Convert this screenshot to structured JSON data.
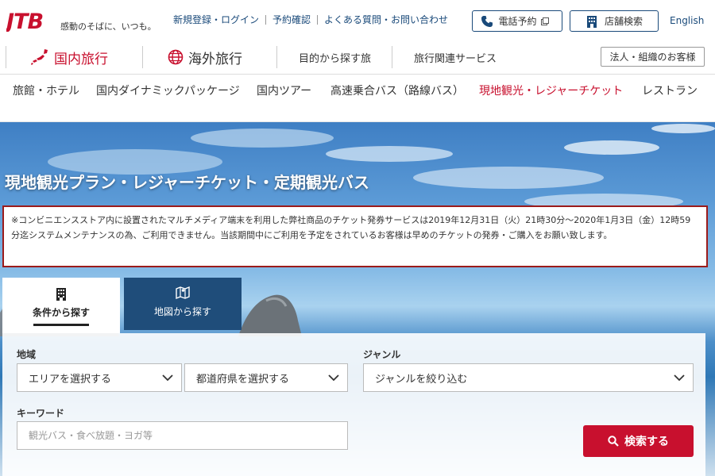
{
  "header": {
    "logo_text": "JTB",
    "tagline": "感動のそばに、いつも。",
    "links": [
      "新規登録・ログイン",
      "予約確認",
      "よくある質問・お問い合わせ"
    ],
    "phone_label": "電話予約",
    "store_label": "店舗検索",
    "english_label": "English"
  },
  "main_nav": {
    "domestic": "国内旅行",
    "overseas": "海外旅行",
    "purpose": "目的から探す旅",
    "related": "旅行関連サービス",
    "corporate": "法人・組織のお客様"
  },
  "sub_nav": [
    {
      "label": "旅館・ホテル",
      "active": false
    },
    {
      "label": "国内ダイナミックパッケージ",
      "active": false
    },
    {
      "label": "国内ツアー",
      "active": false
    },
    {
      "label": "高速乗合バス（路線バス）",
      "active": false
    },
    {
      "label": "現地観光・レジャーチケット",
      "active": true
    },
    {
      "label": "レストラン",
      "active": false
    }
  ],
  "hero": {
    "title": "現地観光プラン・レジャーチケット・定期観光バス",
    "notice": "※コンビニエンスストア内に設置されたマルチメディア端末を利用した弊社商品のチケット発券サービスは2019年12月31日（火）21時30分～2020年1月3日（金）12時59分迄システムメンテナンスの為、ご利用できません。当該期間中にご利用を予定をされているお客様は早めのチケットの発券・ご購入をお願い致します。"
  },
  "search": {
    "tabs": [
      {
        "label": "条件から探す",
        "active": true
      },
      {
        "label": "地図から探す",
        "active": false
      }
    ],
    "region_label": "地域",
    "area_select": "エリアを選択する",
    "prefecture_select": "都道府県を選択する",
    "genre_label": "ジャンル",
    "genre_select": "ジャンルを絞り込む",
    "keyword_label": "キーワード",
    "keyword_placeholder": "観光バス・食べ放題・ヨガ等",
    "keyword_value": "",
    "submit_label": "検索する"
  },
  "colors": {
    "brand_red": "#c8102e",
    "navy": "#1f4d7a",
    "link_blue": "#1a4a7a",
    "notice_border": "#9b1b1b"
  },
  "icons": {
    "phone": "phone-icon",
    "store": "building-icon",
    "domestic": "japan-map-icon",
    "overseas": "globe-icon",
    "condition_tab": "building-icon",
    "map_tab": "map-icon",
    "search": "search-icon"
  }
}
